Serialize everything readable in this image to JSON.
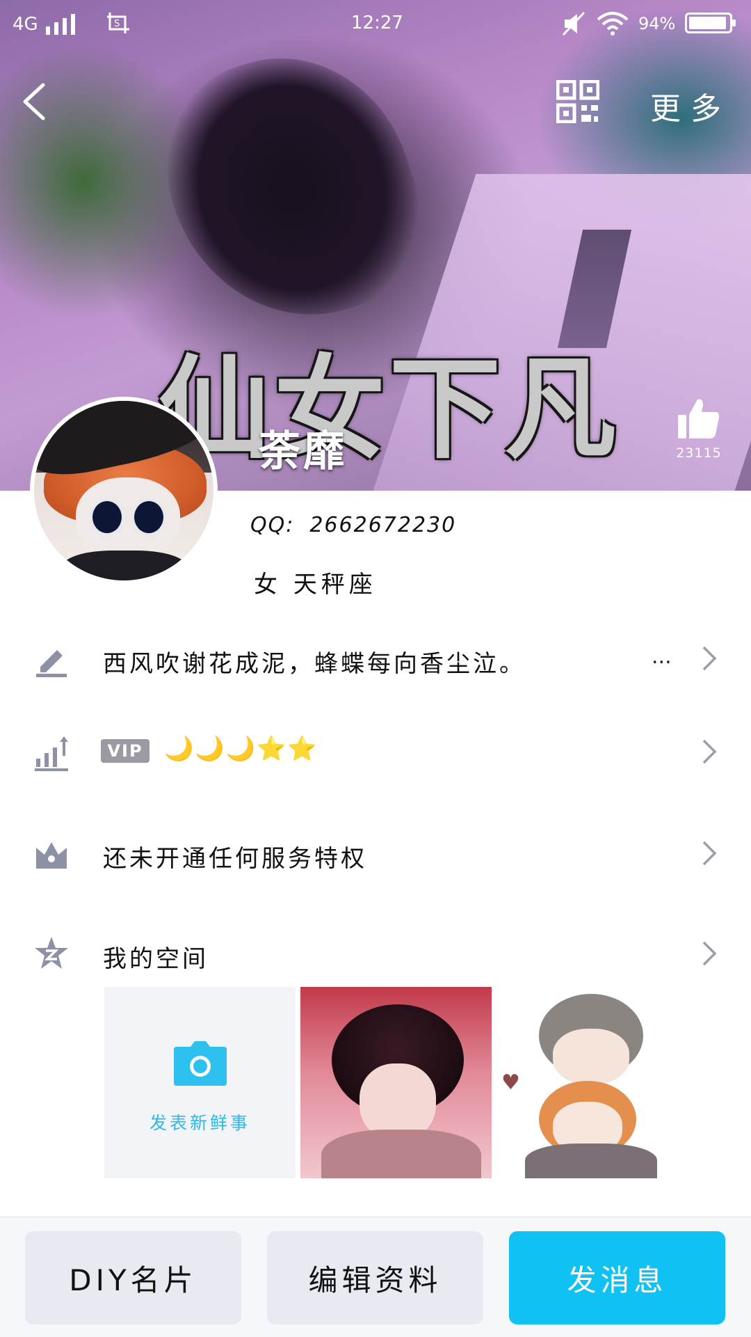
{
  "status_bar": {
    "network": "4G",
    "time": "12:27",
    "battery_text": "94%",
    "battery_level": 0.94
  },
  "nav": {
    "more_label": "更多",
    "qr_icon": "qr-code-icon",
    "back_icon": "back-chevron-icon"
  },
  "cover": {
    "caption": "仙女下凡"
  },
  "profile": {
    "nickname": "荼靡",
    "qq_label": "QQ:",
    "qq_number": "2662672230",
    "gender": "女",
    "constellation": "天秤座",
    "like_count": "23115"
  },
  "rows": {
    "signature": "西风吹谢花成泥，蜂蝶每向香尘泣。",
    "signature_more": "...",
    "vip_badge": "VIP",
    "vip_levels": "🌙🌙🌙⭐⭐",
    "service": "还未开通任何服务特权",
    "qzone": "我的空间"
  },
  "qzone": {
    "post_new": "发表新鲜事"
  },
  "bottom_bar": {
    "diy_card": "DIY名片",
    "edit_profile": "编辑资料",
    "send_message": "发消息"
  },
  "colors": {
    "accent": "#0fc2f3",
    "icon_gray": "#8e90a6",
    "vip_badge": "#9a9aa3",
    "camera": "#2ec0ef"
  }
}
